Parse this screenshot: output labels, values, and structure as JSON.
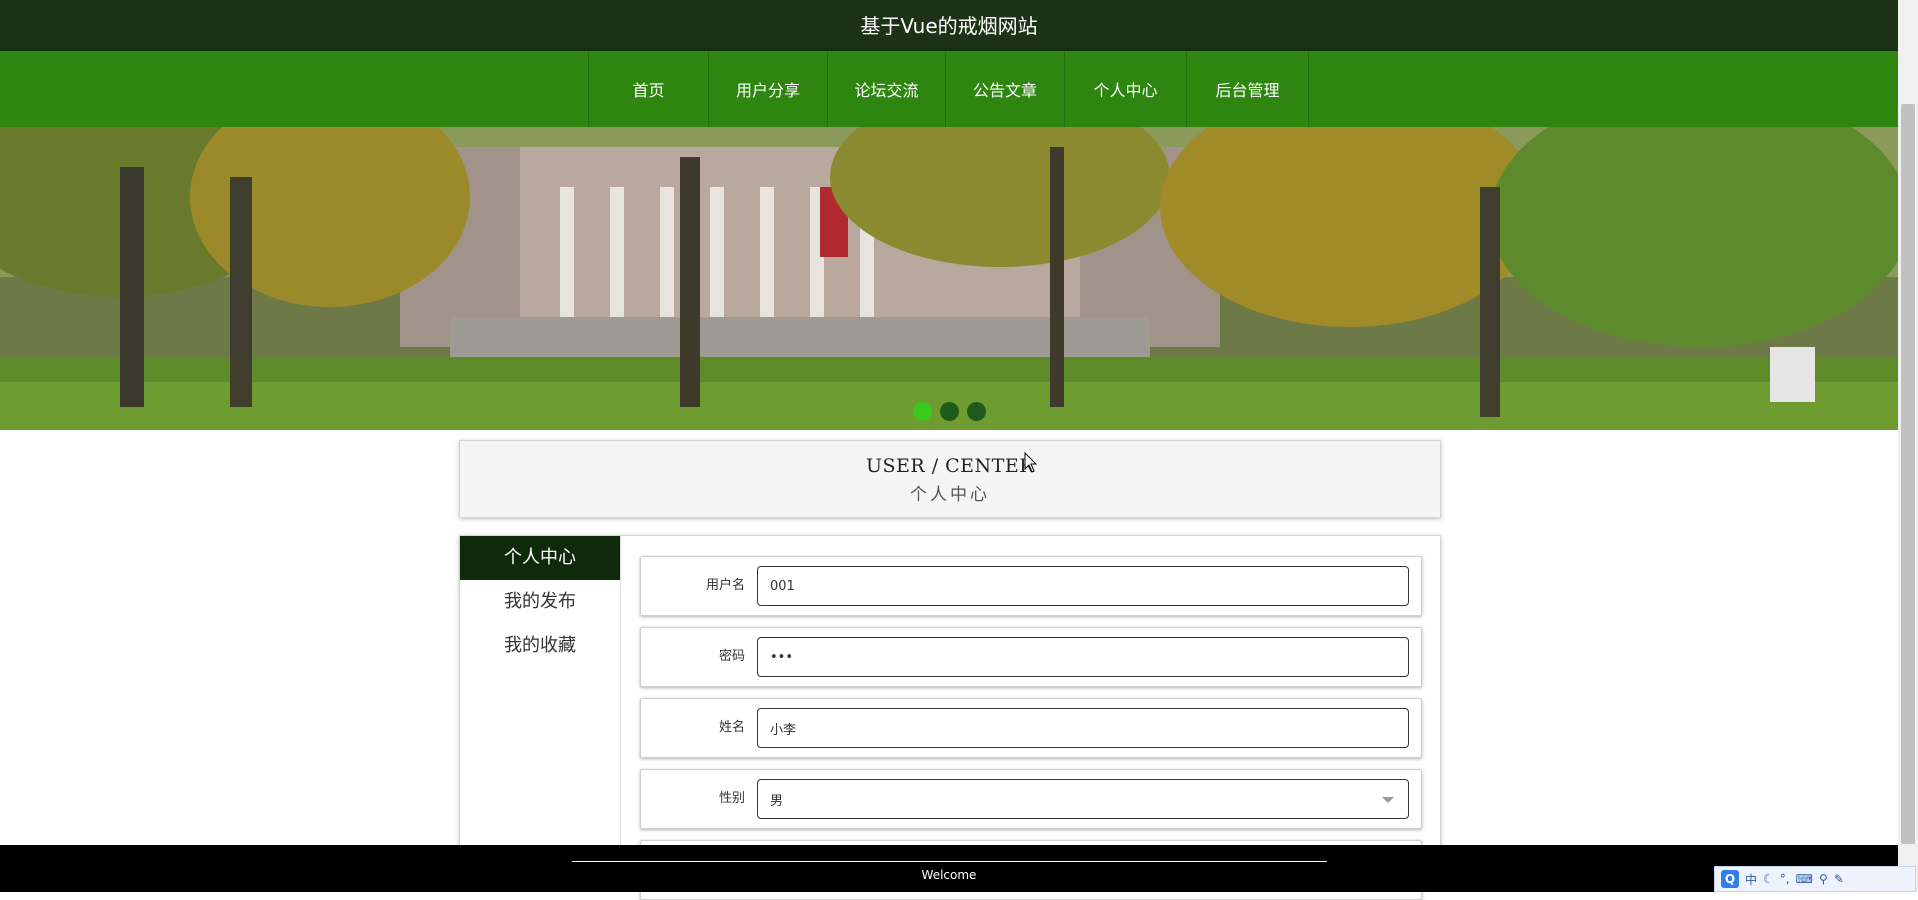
{
  "header": {
    "title": "基于Vue的戒烟网站"
  },
  "nav": {
    "items": [
      "首页",
      "用户分享",
      "论坛交流",
      "公告文章",
      "个人中心",
      "后台管理"
    ]
  },
  "banner": {
    "slide_count": 3,
    "active_slide": 1
  },
  "section": {
    "title_en": "USER / CENTER",
    "title_cn": "个人中心"
  },
  "sidebar": {
    "items": [
      {
        "label": "个人中心",
        "active": true
      },
      {
        "label": "我的发布",
        "active": false
      },
      {
        "label": "我的收藏",
        "active": false
      }
    ]
  },
  "form": {
    "username": {
      "label": "用户名",
      "value": "001"
    },
    "password": {
      "label": "密码",
      "value": "•••"
    },
    "name": {
      "label": "姓名",
      "value": "小李"
    },
    "gender": {
      "label": "性别",
      "value": "男"
    }
  },
  "footer": {
    "text": "Welcome"
  },
  "ime": {
    "mode": "中",
    "icons": [
      "sogou-logo-icon",
      "moon-icon",
      "punctuation-icon",
      "keyboard-icon",
      "toolbox-icon",
      "wrench-icon"
    ]
  },
  "colors": {
    "title_bg": "#1c3318",
    "nav_bg": "#2e8610",
    "sidebar_active_bg": "#0e2a0a",
    "dot_active": "#39c81e",
    "footer_bg": "#000000"
  }
}
